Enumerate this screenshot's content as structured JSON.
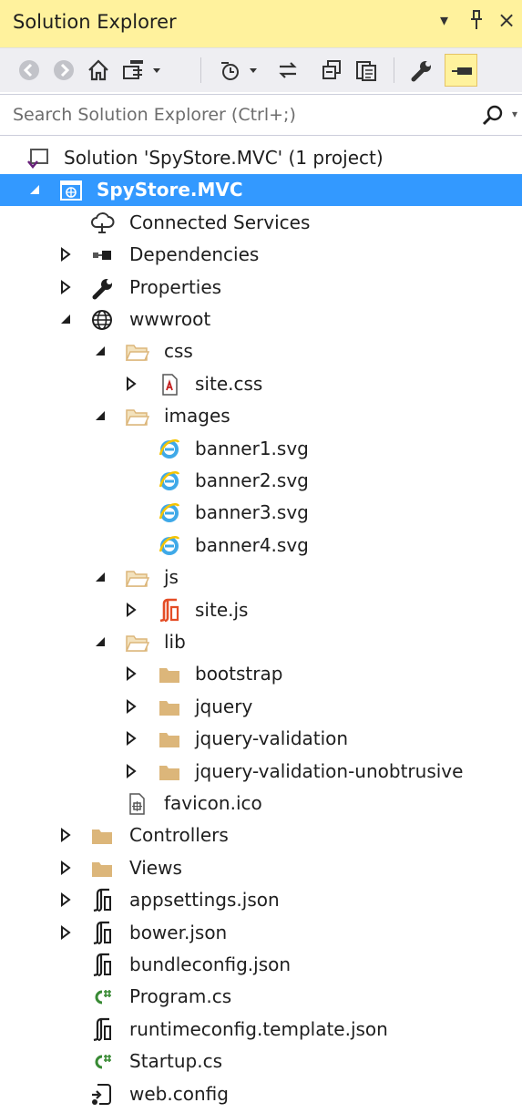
{
  "panel": {
    "title": "Solution Explorer"
  },
  "titlebar_controls": {
    "dropdown": "▾",
    "pin": "ᛘ",
    "close": "×"
  },
  "toolbar": {
    "buttons": [
      {
        "name": "back-button",
        "icon": "back-circle-icon"
      },
      {
        "name": "forward-button",
        "icon": "forward-circle-icon"
      },
      {
        "name": "home-button",
        "icon": "home-icon"
      },
      {
        "name": "switch-views-button",
        "icon": "switch-views-icon"
      },
      {
        "name": "pending-changes-filter-button",
        "icon": "clock-icon"
      },
      {
        "name": "sync-active-document-button",
        "icon": "sync-arrows-icon"
      },
      {
        "name": "collapse-all-button",
        "icon": "collapse-all-icon"
      },
      {
        "name": "show-all-files-button",
        "icon": "show-all-files-icon"
      },
      {
        "name": "properties-button",
        "icon": "wrench-icon"
      },
      {
        "name": "preview-selected-button",
        "icon": "preview-icon",
        "active": true
      }
    ],
    "active_color": "#fff29d"
  },
  "search": {
    "placeholder": "Search Solution Explorer (Ctrl+;)"
  },
  "colors": {
    "titlebar": "#fff29d",
    "selection": "#3399ff",
    "folder": "#dcb67a",
    "csharp": "#388a34",
    "js": "#e44d26"
  },
  "tree": [
    {
      "id": "solution",
      "label": "Solution 'SpyStore.MVC' (1 project)",
      "icon": "solution-icon",
      "level": 0,
      "expander": "none"
    },
    {
      "id": "project",
      "label": "SpyStore.MVC",
      "icon": "web-project-icon",
      "level": 0,
      "expander": "expanded",
      "selected": true
    },
    {
      "id": "connected-services",
      "label": "Connected Services",
      "icon": "connected-services-icon",
      "level": 1,
      "expander": "none"
    },
    {
      "id": "dependencies",
      "label": "Dependencies",
      "icon": "dependencies-icon",
      "level": 1,
      "expander": "collapsed"
    },
    {
      "id": "properties",
      "label": "Properties",
      "icon": "wrench-icon",
      "level": 1,
      "expander": "collapsed"
    },
    {
      "id": "wwwroot",
      "label": "wwwroot",
      "icon": "globe-icon",
      "level": 1,
      "expander": "expanded"
    },
    {
      "id": "css",
      "label": "css",
      "icon": "folder-open-icon",
      "level": 2,
      "expander": "expanded"
    },
    {
      "id": "site-css",
      "label": "site.css",
      "icon": "css-file-icon",
      "level": 3,
      "expander": "collapsed"
    },
    {
      "id": "images",
      "label": "images",
      "icon": "folder-open-icon",
      "level": 2,
      "expander": "expanded"
    },
    {
      "id": "banner1",
      "label": "banner1.svg",
      "icon": "svg-file-icon",
      "level": 3,
      "expander": "none"
    },
    {
      "id": "banner2",
      "label": "banner2.svg",
      "icon": "svg-file-icon",
      "level": 3,
      "expander": "none"
    },
    {
      "id": "banner3",
      "label": "banner3.svg",
      "icon": "svg-file-icon",
      "level": 3,
      "expander": "none"
    },
    {
      "id": "banner4",
      "label": "banner4.svg",
      "icon": "svg-file-icon",
      "level": 3,
      "expander": "none"
    },
    {
      "id": "js",
      "label": "js",
      "icon": "folder-open-icon",
      "level": 2,
      "expander": "expanded"
    },
    {
      "id": "site-js",
      "label": "site.js",
      "icon": "js-file-icon",
      "level": 3,
      "expander": "collapsed"
    },
    {
      "id": "lib",
      "label": "lib",
      "icon": "folder-open-icon",
      "level": 2,
      "expander": "expanded"
    },
    {
      "id": "bootstrap",
      "label": "bootstrap",
      "icon": "folder-icon",
      "level": 3,
      "expander": "collapsed"
    },
    {
      "id": "jquery",
      "label": "jquery",
      "icon": "folder-icon",
      "level": 3,
      "expander": "collapsed"
    },
    {
      "id": "jquery-validation",
      "label": "jquery-validation",
      "icon": "folder-icon",
      "level": 3,
      "expander": "collapsed"
    },
    {
      "id": "jquery-validation-unobtrusive",
      "label": "jquery-validation-unobtrusive",
      "icon": "folder-icon",
      "level": 3,
      "expander": "collapsed"
    },
    {
      "id": "favicon",
      "label": "favicon.ico",
      "icon": "ico-file-icon",
      "level": 2,
      "expander": "none"
    },
    {
      "id": "controllers",
      "label": "Controllers",
      "icon": "folder-icon",
      "level": 1,
      "expander": "collapsed"
    },
    {
      "id": "views",
      "label": "Views",
      "icon": "folder-icon",
      "level": 1,
      "expander": "collapsed"
    },
    {
      "id": "appsettings",
      "label": "appsettings.json",
      "icon": "json-file-icon",
      "level": 1,
      "expander": "collapsed"
    },
    {
      "id": "bower",
      "label": "bower.json",
      "icon": "json-file-icon",
      "level": 1,
      "expander": "collapsed"
    },
    {
      "id": "bundleconfig",
      "label": "bundleconfig.json",
      "icon": "json-file-icon",
      "level": 1,
      "expander": "none"
    },
    {
      "id": "program",
      "label": "Program.cs",
      "icon": "csharp-file-icon",
      "level": 1,
      "expander": "none"
    },
    {
      "id": "runtimeconfig",
      "label": "runtimeconfig.template.json",
      "icon": "json-file-icon",
      "level": 1,
      "expander": "none"
    },
    {
      "id": "startup",
      "label": "Startup.cs",
      "icon": "csharp-file-icon",
      "level": 1,
      "expander": "none"
    },
    {
      "id": "webconfig",
      "label": "web.config",
      "icon": "config-file-icon",
      "level": 1,
      "expander": "none"
    }
  ]
}
